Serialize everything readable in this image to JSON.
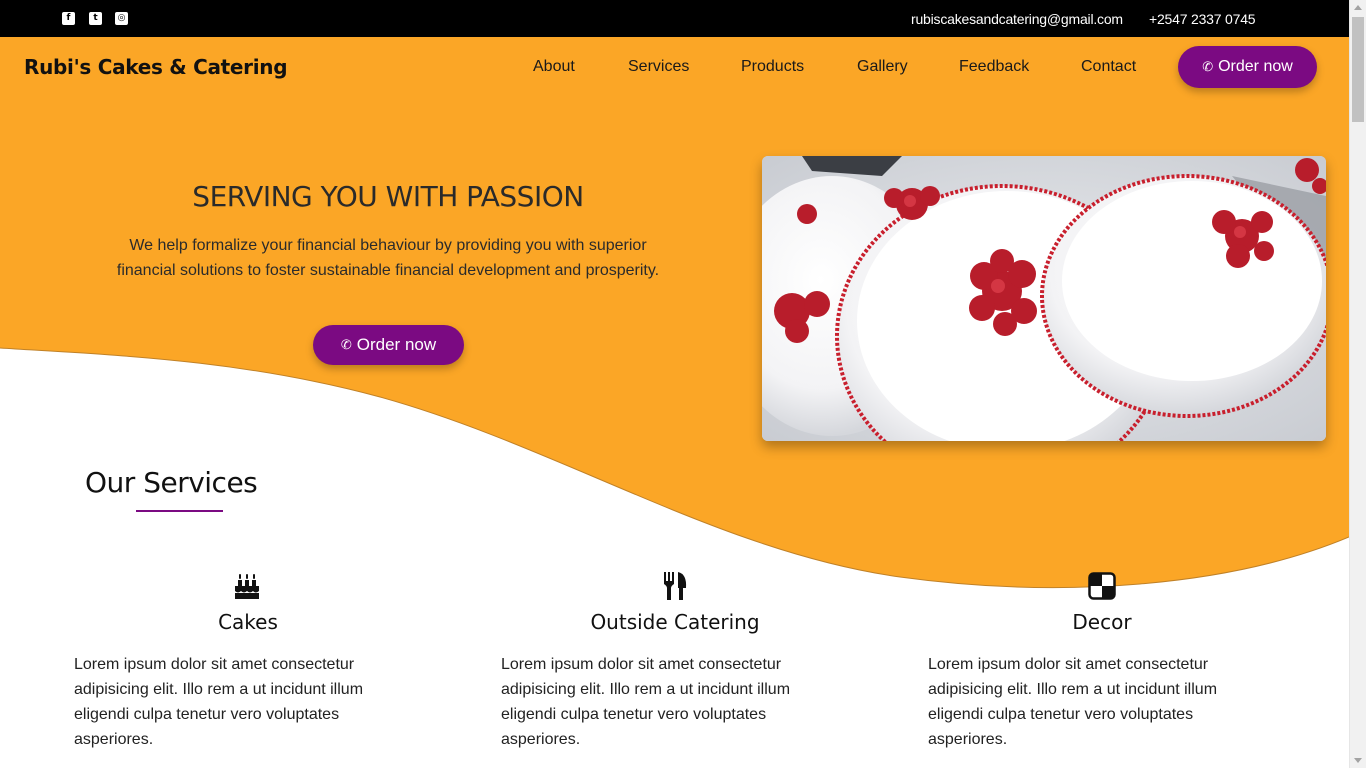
{
  "topbar": {
    "social": [
      {
        "name": "facebook-icon",
        "glyph": "f"
      },
      {
        "name": "twitter-icon",
        "glyph": "t"
      },
      {
        "name": "instagram-icon",
        "glyph": "◎"
      }
    ],
    "email": "rubiscakesandcatering@gmail.com",
    "phone": "+2547 2337 0745"
  },
  "nav": {
    "brand": "Rubi's Cakes & Catering",
    "links": [
      "About",
      "Services",
      "Products",
      "Gallery",
      "Feedback",
      "Contact"
    ],
    "order_label": "Order now"
  },
  "hero": {
    "title": "SERVING YOU WITH PASSION",
    "text": "We help formalize your financial behaviour by providing you with superior financial solutions to foster sustainable financial development and prosperity.",
    "order_label": "Order now",
    "image_alt": "white cakes with red roses"
  },
  "services": {
    "title": "Our Services",
    "items": [
      {
        "title": "Cakes",
        "icon": "birthday-cake-icon",
        "text": "Lorem ipsum dolor sit amet consectetur adipisicing elit. Illo rem a ut incidunt illum eligendi culpa tenetur vero voluptates asperiores."
      },
      {
        "title": "Outside Catering",
        "icon": "utensils-icon",
        "text": "Lorem ipsum dolor sit amet consectetur adipisicing elit. Illo rem a ut incidunt illum eligendi culpa tenetur vero voluptates asperiores."
      },
      {
        "title": "Decor",
        "icon": "decor-icon",
        "text": "Lorem ipsum dolor sit amet consectetur adipisicing elit. Illo rem a ut incidunt illum eligendi culpa tenetur vero voluptates asperiores."
      }
    ]
  },
  "colors": {
    "accent": "#7b0a82",
    "orange": "#fba626",
    "topbar": "#000000"
  }
}
